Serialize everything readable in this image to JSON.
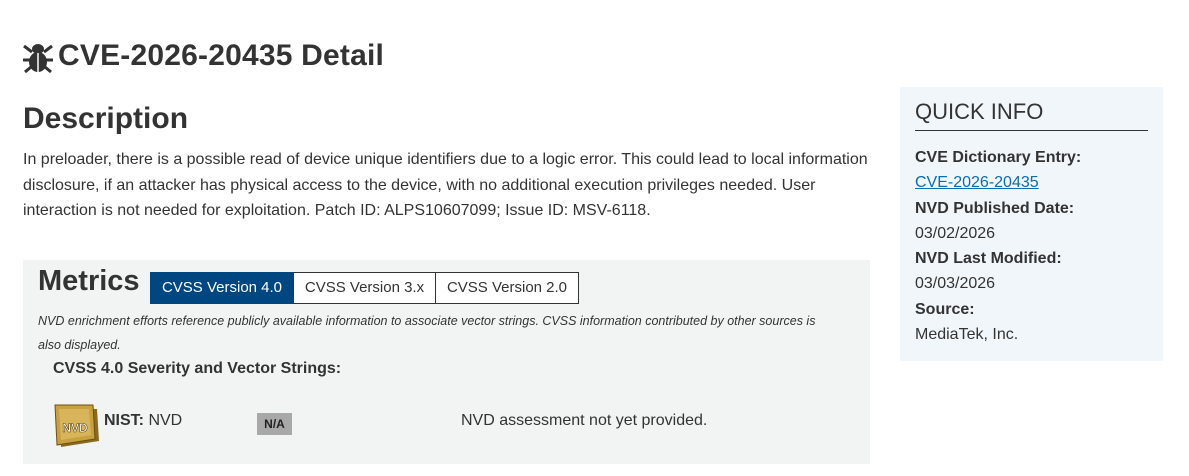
{
  "header": {
    "title": "CVE-2026-20435 Detail",
    "icon": "bug-icon"
  },
  "description": {
    "heading": "Description",
    "text": "In preloader, there is a possible read of device unique identifiers due to a logic error. This could lead to local information disclosure, if an attacker has physical access to the device, with no additional execution privileges needed. User interaction is not needed for exploitation. Patch ID: ALPS10607099; Issue ID: MSV-6118."
  },
  "metrics": {
    "heading": "Metrics",
    "tabs": [
      {
        "label": "CVSS Version 4.0",
        "active": true
      },
      {
        "label": "CVSS Version 3.x",
        "active": false
      },
      {
        "label": "CVSS Version 2.0",
        "active": false
      }
    ],
    "note": "NVD enrichment efforts reference publicly available information to associate vector strings. CVSS information contributed by other sources is also displayed.",
    "severity_heading": "CVSS 4.0 Severity and Vector Strings:",
    "nist": {
      "badge_text": "NVD",
      "label": "NIST:",
      "source": "NVD",
      "score_badge": "N/A",
      "assessment": "NVD assessment not yet provided."
    }
  },
  "quick_info": {
    "heading": "QUICK INFO",
    "cve_entry_label": "CVE Dictionary Entry:",
    "cve_entry_value": "CVE-2026-20435",
    "published_label": "NVD Published Date:",
    "published_value": "03/02/2026",
    "modified_label": "NVD Last Modified:",
    "modified_value": "03/03/2026",
    "source_label": "Source:",
    "source_value": "MediaTek, Inc."
  },
  "colors": {
    "active_tab": "#004680",
    "link": "#0b6cb0",
    "metrics_bg": "#f2f4f4",
    "quick_info_bg": "#f1f6fb",
    "badge_gray": "#a8a8a8",
    "nvd_badge_gold": "#c9a040"
  }
}
